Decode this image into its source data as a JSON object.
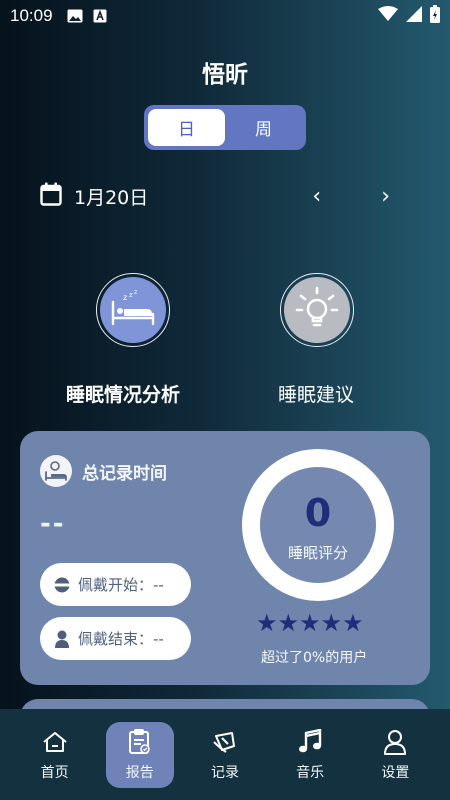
{
  "status_bar": {
    "time": "10:09",
    "icons": [
      "image-icon",
      "text-a-icon",
      "wifi-icon",
      "signal-icon",
      "battery-icon"
    ]
  },
  "app": {
    "title": "悟昕"
  },
  "segment": {
    "day": "日",
    "week": "周",
    "selected": "日"
  },
  "date": {
    "label": "1月20日",
    "prev": "‹",
    "next": "›"
  },
  "features": {
    "analysis": {
      "label": "睡眠情况分析",
      "icon": "sleep-bed-icon"
    },
    "advice": {
      "label": "睡眠建议",
      "icon": "lightbulb-icon"
    }
  },
  "card": {
    "title": "总记录时间",
    "total_value": "--",
    "wear_start": "佩戴开始：--",
    "wear_end": "佩戴结束：--",
    "score": "0",
    "score_label": "睡眠评分",
    "stars_filled": 5,
    "stars": "★★★★★",
    "exceed_text": "超过了0%的用户"
  },
  "tabs": [
    {
      "label": "首页",
      "icon": "home-icon"
    },
    {
      "label": "报告",
      "icon": "report-icon",
      "active": true
    },
    {
      "label": "记录",
      "icon": "record-icon"
    },
    {
      "label": "音乐",
      "icon": "music-icon"
    },
    {
      "label": "设置",
      "icon": "settings-icon"
    }
  ],
  "colors": {
    "accent": "#6276c2",
    "card": "#6f85ab",
    "score": "#222d7a"
  }
}
